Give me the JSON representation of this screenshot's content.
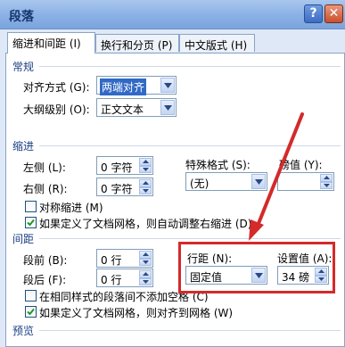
{
  "window": {
    "title": "段落"
  },
  "tabs": [
    {
      "label": "缩进和间距 (I)"
    },
    {
      "label": "换行和分页 (P)"
    },
    {
      "label": "中文版式 (H)"
    }
  ],
  "general": {
    "heading": "常规",
    "alignment_label": "对齐方式 (G):",
    "alignment_value": "两端对齐",
    "outline_label": "大纲级别 (O):",
    "outline_value": "正文文本"
  },
  "indent": {
    "heading": "缩进",
    "left_label": "左侧 (L):",
    "left_value": "0 字符",
    "right_label": "右侧 (R):",
    "right_value": "0 字符",
    "special_label": "特殊格式 (S):",
    "special_value": "(无)",
    "by_label": "磅值 (Y):",
    "by_value": "",
    "mirror_label": "对称缩进 (M)",
    "mirror_checked": false,
    "grid_label": "如果定义了文档网格，则自动调整右缩进 (D)",
    "grid_checked": true
  },
  "spacing": {
    "heading": "间距",
    "before_label": "段前 (B):",
    "before_value": "0 行",
    "after_label": "段后 (F):",
    "after_value": "0 行",
    "line_label": "行距 (N):",
    "line_value": "固定值",
    "at_label": "设置值 (A):",
    "at_value": "34 磅",
    "no_space_label": "在相同样式的段落间不添加空格 (C)",
    "no_space_checked": false,
    "snap_label": "如果定义了文档网格，则对齐到网格 (W)",
    "snap_checked": true
  },
  "preview": {
    "heading": "预览"
  },
  "icons": {
    "help": "help-icon",
    "close": "close-icon",
    "dropdown": "chevron-down-icon",
    "spin": "spinner-arrows-icon",
    "check": "checkmark-icon"
  },
  "colors": {
    "selection": "#3169c6",
    "annotation": "#d42a2a",
    "section_text": "#1b3f85"
  }
}
